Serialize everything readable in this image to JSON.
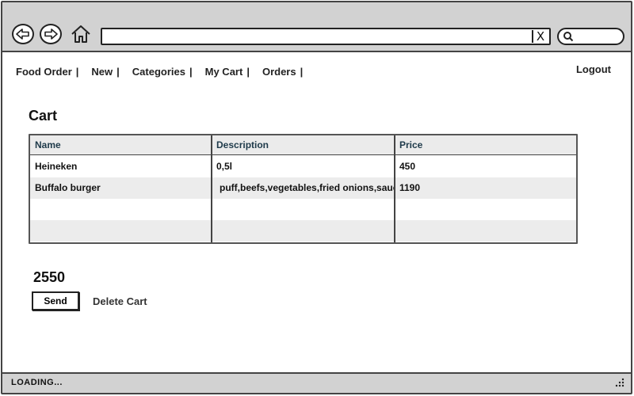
{
  "browser": {
    "back_icon": "back-arrow-icon",
    "forward_icon": "forward-arrow-icon",
    "home_icon": "home-icon",
    "address_value": "",
    "clear_icon": "close-icon",
    "clear_glyph": "X",
    "search_icon": "search-icon",
    "search_value": ""
  },
  "nav": {
    "items": [
      {
        "label": "Food Order",
        "sep": "|"
      },
      {
        "label": "New",
        "sep": "|"
      },
      {
        "label": "Categories",
        "sep": "|"
      },
      {
        "label": "My Cart",
        "sep": "|"
      },
      {
        "label": "Orders",
        "sep": "|"
      }
    ],
    "logout": "Logout"
  },
  "page": {
    "title": "Cart"
  },
  "cart_table": {
    "columns": [
      "Name",
      "Description",
      "Price"
    ],
    "rows": [
      [
        "Heineken",
        "0,5l",
        "450"
      ],
      [
        "Buffalo burger",
        "puff,beefs,vegetables,fried onions,sauce",
        "1190"
      ],
      [
        "",
        "",
        ""
      ],
      [
        "",
        "",
        ""
      ]
    ]
  },
  "total": "2550",
  "actions": {
    "send": "Send",
    "delete": "Delete Cart"
  },
  "status": {
    "text": "LOADING...",
    "grip_icon": "resize-grip-icon"
  },
  "colors": {
    "chrome": "#d2d2d2",
    "border": "#444444",
    "alt_row": "#ececec",
    "header_text": "#1e3a4a"
  }
}
